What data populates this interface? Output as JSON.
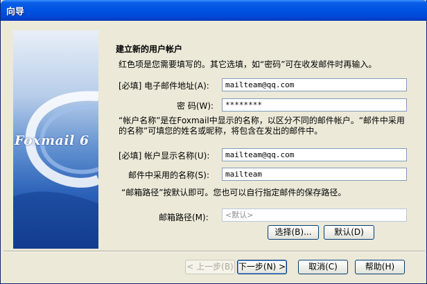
{
  "window": {
    "title": "向导"
  },
  "banner": {
    "logo_text": "Foxmail 6"
  },
  "form": {
    "heading": "建立新的用户帐户",
    "intro": "红色项是您需要填写的。其它选填，如“密码”可在收发邮件时再输入。",
    "email_label": "[必填] 电子邮件地址(A):",
    "email_value": "mailteam@qq.com",
    "password_label": "密 码(W):",
    "password_value": "********",
    "account_note": "“帐户名称”是在Foxmail中显示的名称，以区分不同的邮件帐户。“邮件中采用的名称”可填您的姓名或昵称，将包含在发出的邮件中。",
    "display_name_label": "[必填] 帐户显示名称(U):",
    "display_name_value": "mailteam@qq.com",
    "mail_name_label": "邮件中采用的名称(S):",
    "mail_name_value": "mailteam",
    "path_note": "“邮箱路径”按默认即可。您也可以自行指定邮件的保存路径。",
    "path_label": "邮箱路径(M):",
    "path_value": "<默认>",
    "browse_button": "选择(B)...",
    "default_button": "默认(D)"
  },
  "footer": {
    "back_button": "< 上一步(B)",
    "next_button": "下一步(N) >",
    "cancel_button": "取消(C)",
    "help_button": "帮助(H)"
  }
}
